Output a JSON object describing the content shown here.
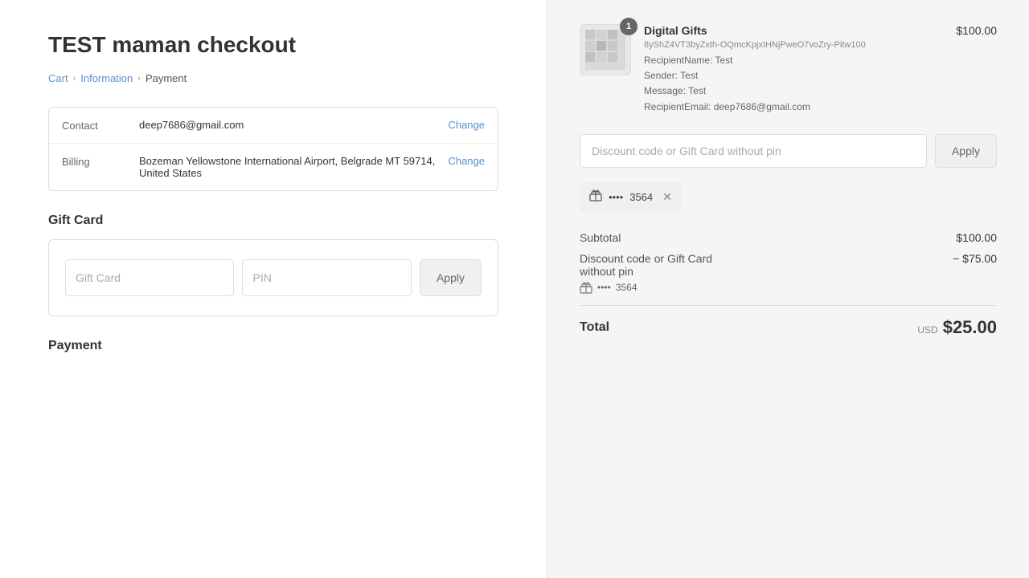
{
  "page": {
    "title": "TEST maman checkout"
  },
  "breadcrumb": {
    "cart": "Cart",
    "information": "Information",
    "payment": "Payment"
  },
  "contact": {
    "label": "Contact",
    "value": "deep7686@gmail.com",
    "change": "Change"
  },
  "billing": {
    "label": "Billing",
    "value": "Bozeman Yellowstone International Airport, Belgrade MT 59714, United States",
    "change": "Change"
  },
  "gift_card_section": {
    "title": "Gift Card",
    "card_placeholder": "Gift Card",
    "pin_placeholder": "PIN",
    "apply_label": "Apply"
  },
  "payment_section": {
    "title": "Payment"
  },
  "right_panel": {
    "product": {
      "badge": "1",
      "name": "Digital Gifts",
      "sku": "8yShZ4VT3byZxth-OQmcKpjxIHNjPweO7voZry-Pitw100",
      "recipient": "RecipientName: Test",
      "sender": "Sender: Test",
      "message": "Message: Test",
      "recipient_email": "RecipientEmail: deep7686@gmail.com",
      "price": "$100.00"
    },
    "discount_input": {
      "placeholder": "Discount code or Gift Card without pin",
      "apply_label": "Apply"
    },
    "applied_tag": {
      "dots": "••••",
      "last4": "3564"
    },
    "totals": {
      "subtotal_label": "Subtotal",
      "subtotal_value": "$100.00",
      "discount_label": "Discount code or Gift Card",
      "discount_sub": "without pin",
      "discount_value": "− $75.00",
      "discount_tag_dots": "••••",
      "discount_tag_last4": "3564",
      "total_label": "Total",
      "total_currency": "USD",
      "total_value": "$25.00"
    }
  }
}
